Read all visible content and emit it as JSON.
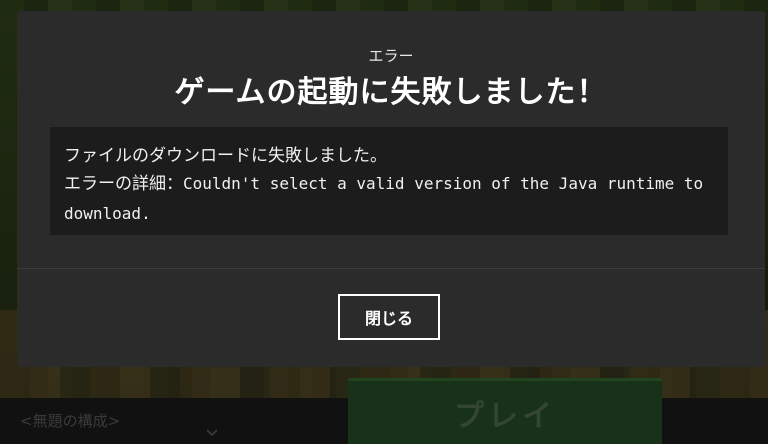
{
  "dialog": {
    "subtitle": "エラー",
    "title": "ゲームの起動に失敗しました！",
    "message": "ファイルのダウンロードに失敗しました。",
    "detail_label": "エラーの詳細：",
    "detail_text": "Couldn't select a valid version of the Java runtime to download.",
    "close_label": "閉じる"
  },
  "launcher": {
    "profile_label": "<無題の構成>",
    "play_label": "プレイ"
  },
  "icons": {
    "profile_chevron": "chevron-down-icon"
  }
}
